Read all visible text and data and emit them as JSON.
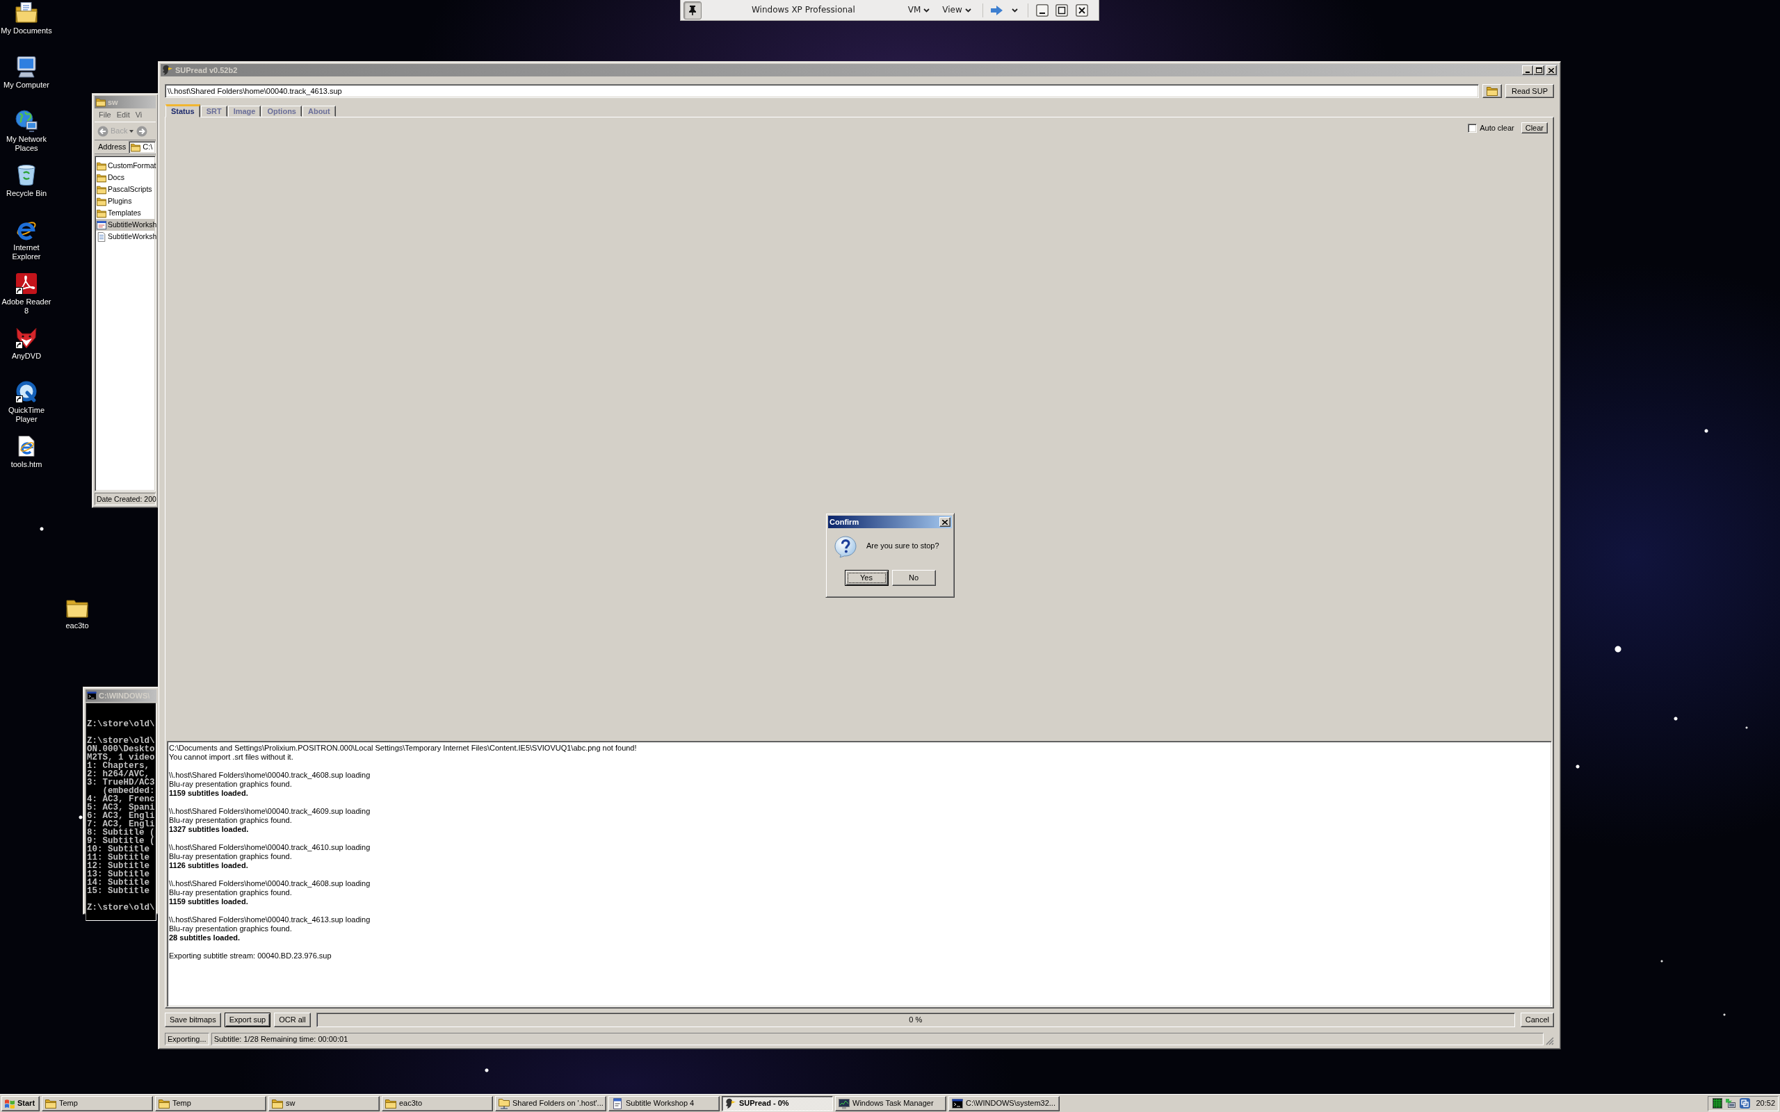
{
  "vm_toolbar": {
    "title": "Windows XP Professional",
    "menus": [
      "VM",
      "View"
    ]
  },
  "desktop_icons": [
    {
      "label": "My Documents",
      "kind": "documents",
      "shortcut": false
    },
    {
      "label": "My Computer",
      "kind": "computer",
      "shortcut": false
    },
    {
      "label": "My Network Places",
      "kind": "network",
      "shortcut": false
    },
    {
      "label": "Recycle Bin",
      "kind": "recycle",
      "shortcut": false
    },
    {
      "label": "Internet Explorer",
      "kind": "browser",
      "shortcut": false
    },
    {
      "label": "Adobe Reader 8",
      "kind": "reader",
      "shortcut": true
    },
    {
      "label": "AnyDVD",
      "kind": "fox",
      "shortcut": true
    },
    {
      "label": "QuickTime Player",
      "kind": "player",
      "shortcut": true
    },
    {
      "label": "tools.htm",
      "kind": "webpage",
      "shortcut": false
    }
  ],
  "loose_icons": [
    {
      "label": "eac3to",
      "kind": "folder",
      "shortcut": false
    }
  ],
  "explorer_window": {
    "title": "sw",
    "menu": [
      "File",
      "Edit",
      "Vi"
    ],
    "back": {
      "label": "Back",
      "disabled": true
    },
    "address_label": "Address",
    "address": "C:\\",
    "items": [
      {
        "name": "CustomFormat",
        "kind": "folder",
        "selected": false
      },
      {
        "name": "Docs",
        "kind": "folder",
        "selected": false
      },
      {
        "name": "PascalScripts",
        "kind": "folder",
        "selected": false
      },
      {
        "name": "Plugins",
        "kind": "folder",
        "selected": false
      },
      {
        "name": "Templates",
        "kind": "folder",
        "selected": false
      },
      {
        "name": "SubtitleWorksh",
        "kind": "exe",
        "selected": true
      },
      {
        "name": "SubtitleWorksh",
        "kind": "textfile",
        "selected": false
      }
    ],
    "status": "Date Created: 200"
  },
  "console_window": {
    "title": "C:\\WINDOWS\\",
    "blocks": [
      [
        "Z:\\store\\old\\"
      ],
      [
        "Z:\\store\\old\\",
        "ON.000\\Deskto",
        "M2TS, 1 video",
        "1: Chapters,",
        "2: h264/AVC,",
        "3: TrueHD/AC3",
        "   (embedded:",
        "4: AC3, Frenc",
        "5: AC3, Spani",
        "6: AC3, Engli",
        "7: AC3, Engli",
        "8: Subtitle (",
        "9: Subtitle (",
        "10: Subtitle",
        "11: Subtitle",
        "12: Subtitle",
        "13: Subtitle",
        "14: Subtitle",
        "15: Subtitle"
      ],
      [
        "Z:\\store\\old\\"
      ]
    ]
  },
  "supread_window": {
    "title": "SUPread v0.52b2",
    "path": "\\\\.host\\Shared Folders\\home\\00040.track_4613.sup",
    "read_button": "Read SUP",
    "tabs": [
      {
        "label": "Status",
        "selected": true
      },
      {
        "label": "SRT",
        "selected": false
      },
      {
        "label": "Image",
        "selected": false
      },
      {
        "label": "Options",
        "selected": false
      },
      {
        "label": "About",
        "selected": false
      }
    ],
    "auto_clear": {
      "label": "Auto clear",
      "checked": false
    },
    "clear_button": "Clear",
    "log": [
      {
        "lines": [
          {
            "text": "C:\\Documents and Settings\\Prolixium.POSITRON.000\\Local Settings\\Temporary Internet Files\\Content.IE5\\SVIOVUQ1\\abc.png not found!",
            "bold": false
          },
          {
            "text": "You cannot import .srt files without it.",
            "bold": false
          }
        ]
      },
      {
        "lines": [
          {
            "text": "\\\\.host\\Shared Folders\\home\\00040.track_4608.sup loading",
            "bold": false
          },
          {
            "text": "Blu-ray presentation graphics found.",
            "bold": false
          },
          {
            "text": "1159 subtitles loaded.",
            "bold": true
          }
        ]
      },
      {
        "lines": [
          {
            "text": "\\\\.host\\Shared Folders\\home\\00040.track_4609.sup loading",
            "bold": false
          },
          {
            "text": "Blu-ray presentation graphics found.",
            "bold": false
          },
          {
            "text": "1327 subtitles loaded.",
            "bold": true
          }
        ]
      },
      {
        "lines": [
          {
            "text": "\\\\.host\\Shared Folders\\home\\00040.track_4610.sup loading",
            "bold": false
          },
          {
            "text": "Blu-ray presentation graphics found.",
            "bold": false
          },
          {
            "text": "1126 subtitles loaded.",
            "bold": true
          }
        ]
      },
      {
        "lines": [
          {
            "text": "\\\\.host\\Shared Folders\\home\\00040.track_4608.sup loading",
            "bold": false
          },
          {
            "text": "Blu-ray presentation graphics found.",
            "bold": false
          },
          {
            "text": "1159 subtitles loaded.",
            "bold": true
          }
        ]
      },
      {
        "lines": [
          {
            "text": "\\\\.host\\Shared Folders\\home\\00040.track_4613.sup loading",
            "bold": false
          },
          {
            "text": "Blu-ray presentation graphics found.",
            "bold": false
          },
          {
            "text": "28 subtitles loaded.",
            "bold": true
          }
        ]
      },
      {
        "lines": [
          {
            "text": "Exporting subtitle stream: 00040.BD.23.976.sup",
            "bold": false
          }
        ]
      }
    ],
    "actions": [
      {
        "label": "Save bitmaps",
        "focused": false
      },
      {
        "label": "Export sup",
        "focused": true
      },
      {
        "label": "OCR all",
        "focused": false
      }
    ],
    "progress": {
      "level": 0,
      "reading": "0 %"
    },
    "cancel_button": "Cancel",
    "status_bar": [
      "Exporting...",
      "Subtitle: 1/28 Remaining time: 00:00:01"
    ]
  },
  "confirm_dialog": {
    "title": "Confirm",
    "message": "Are you sure to stop?",
    "buttons": [
      {
        "label": "Yes",
        "default": true
      },
      {
        "label": "No",
        "default": false
      }
    ]
  },
  "taskbar": {
    "start": "Start",
    "tasks": [
      {
        "label": "Temp",
        "kind": "folder",
        "selected": false
      },
      {
        "label": "Temp",
        "kind": "folder",
        "selected": false
      },
      {
        "label": "sw",
        "kind": "folder",
        "selected": false
      },
      {
        "label": "eac3to",
        "kind": "folder",
        "selected": false
      },
      {
        "label": "Shared Folders on '.host'...",
        "kind": "netfolder",
        "selected": false
      },
      {
        "label": "Subtitle Workshop 4",
        "kind": "docapp",
        "selected": false
      },
      {
        "label": "SUPread - 0%",
        "kind": "bird",
        "selected": true
      },
      {
        "label": "Windows Task Manager",
        "kind": "monitor",
        "selected": false
      },
      {
        "label": "C:\\WINDOWS\\system32...",
        "kind": "console",
        "selected": false
      }
    ],
    "clock": "20:52"
  }
}
